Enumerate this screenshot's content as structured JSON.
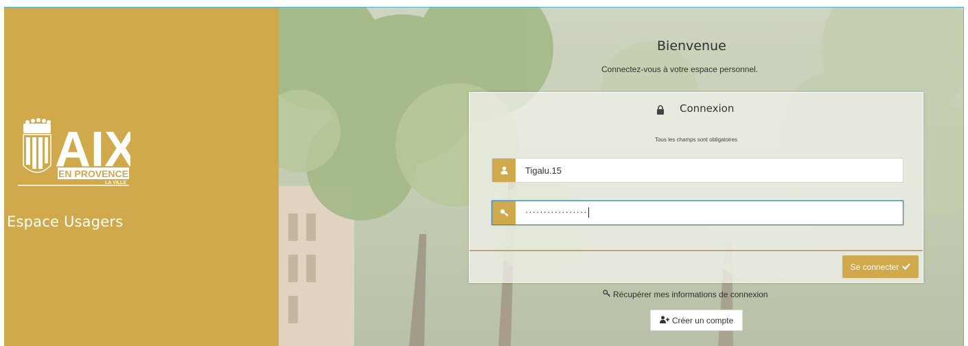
{
  "sidebar": {
    "logo_text": "AIX",
    "logo_subtext": "EN PROVENCE",
    "logo_tagline": "LA VILLE",
    "title": "Espace Usagers"
  },
  "welcome": {
    "title": "Bienvenue",
    "subtitle": "Connectez-vous à votre espace personnel."
  },
  "login": {
    "title": "Connexion",
    "note": "Tous les champs sont obligatoires",
    "username_value": "Tigalu.15",
    "password_mask": "·················",
    "submit_label": "Se connecter"
  },
  "links": {
    "recover": "Récupérer mes informations de connexion",
    "create_account": "Créer un compte"
  },
  "icons": {
    "lock": "lock-icon",
    "user": "user-icon",
    "key": "key-icon",
    "check": "check-icon",
    "add_user": "add-user-icon"
  },
  "colors": {
    "gold": "#cfa94b",
    "focus": "#3a7fa9",
    "frame": "#4fb3c9"
  }
}
